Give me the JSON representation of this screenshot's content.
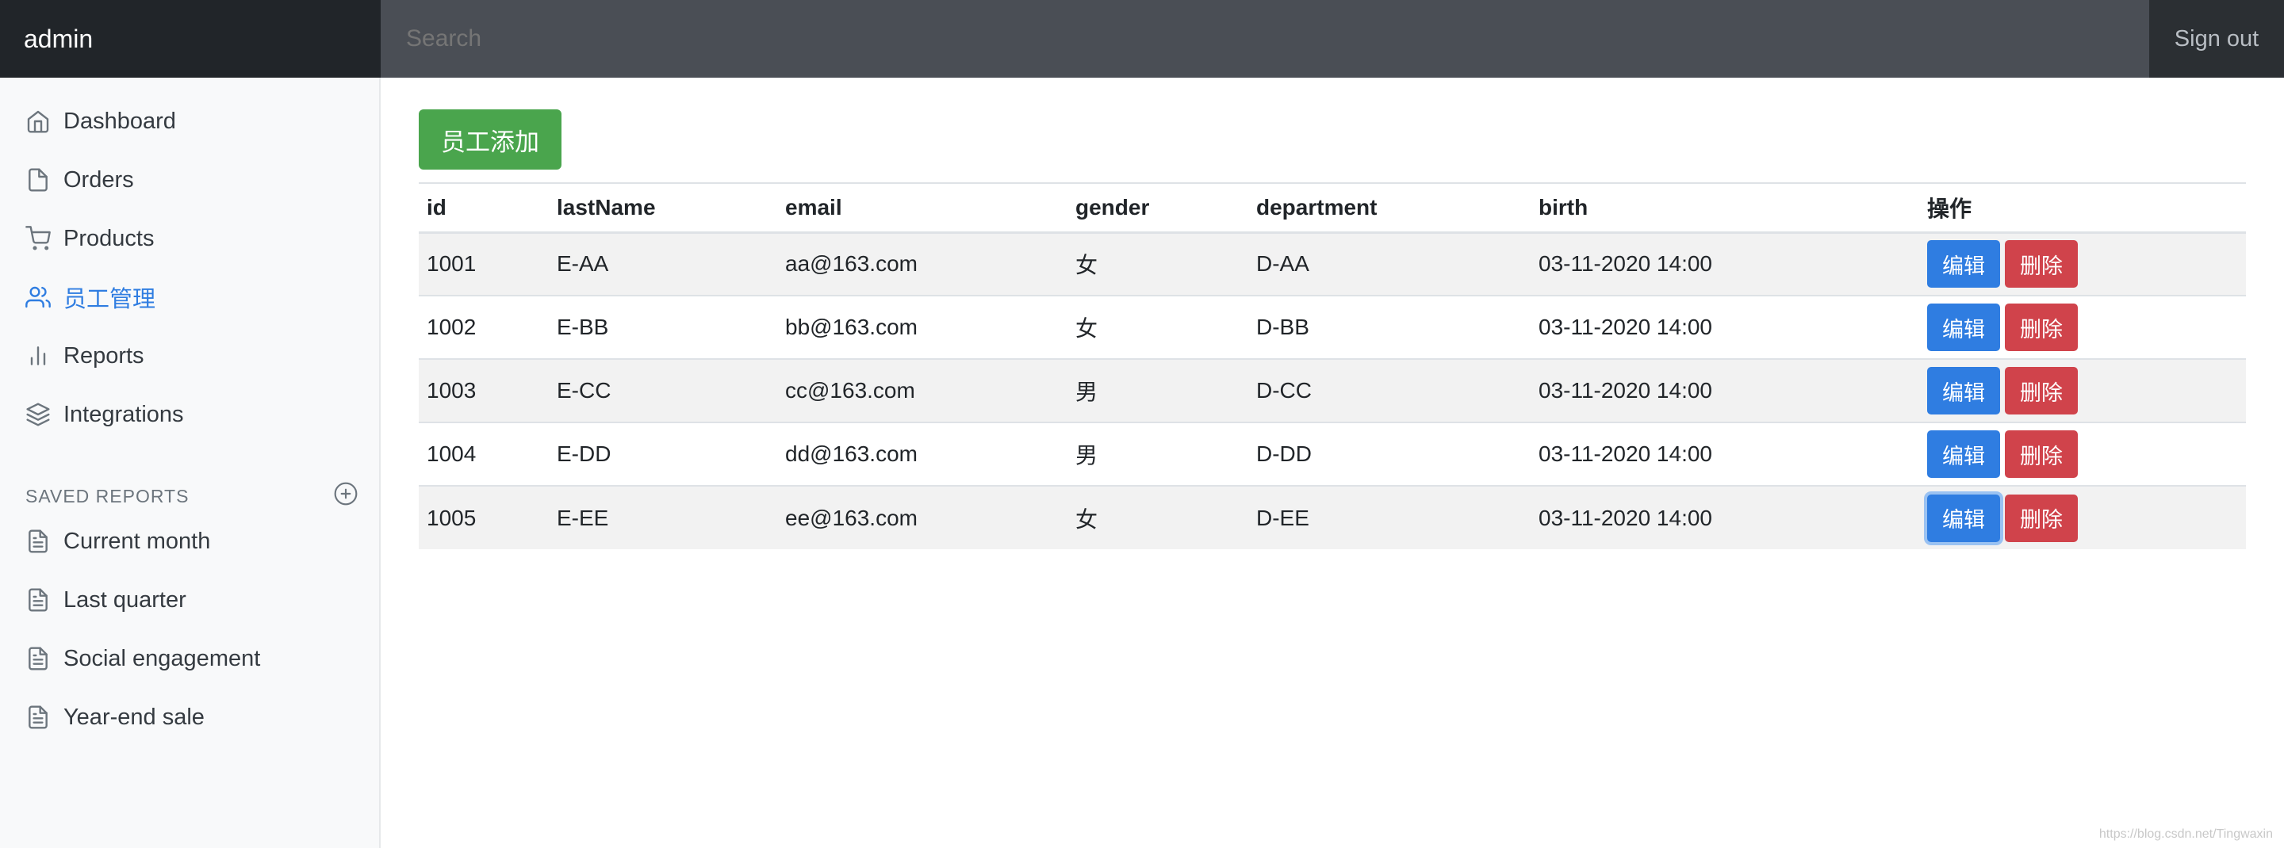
{
  "navbar": {
    "brand": "admin",
    "search_placeholder": "Search",
    "signout_label": "Sign out"
  },
  "sidebar": {
    "items": [
      {
        "label": "Dashboard",
        "icon": "home-icon"
      },
      {
        "label": "Orders",
        "icon": "file-icon"
      },
      {
        "label": "Products",
        "icon": "shopping-cart-icon"
      },
      {
        "label": "员工管理",
        "icon": "users-icon",
        "active": true
      },
      {
        "label": "Reports",
        "icon": "bar-chart-icon"
      },
      {
        "label": "Integrations",
        "icon": "layers-icon"
      }
    ],
    "saved_heading": "SAVED REPORTS",
    "saved_items": [
      {
        "label": "Current month",
        "icon": "file-text-icon"
      },
      {
        "label": "Last quarter",
        "icon": "file-text-icon"
      },
      {
        "label": "Social engagement",
        "icon": "file-text-icon"
      },
      {
        "label": "Year-end sale",
        "icon": "file-text-icon"
      }
    ]
  },
  "main": {
    "add_button": "员工添加",
    "table": {
      "headers": [
        "id",
        "lastName",
        "email",
        "gender",
        "department",
        "birth",
        "操作"
      ],
      "rows": [
        [
          "1001",
          "E-AA",
          "aa@163.com",
          "女",
          "D-AA",
          "03-11-2020 14:00"
        ],
        [
          "1002",
          "E-BB",
          "bb@163.com",
          "女",
          "D-BB",
          "03-11-2020 14:00"
        ],
        [
          "1003",
          "E-CC",
          "cc@163.com",
          "男",
          "D-CC",
          "03-11-2020 14:00"
        ],
        [
          "1004",
          "E-DD",
          "dd@163.com",
          "男",
          "D-DD",
          "03-11-2020 14:00"
        ],
        [
          "1005",
          "E-EE",
          "ee@163.com",
          "女",
          "D-EE",
          "03-11-2020 14:00"
        ]
      ],
      "edit_label": "编辑",
      "delete_label": "删除"
    }
  },
  "watermark": "https://blog.csdn.net/Tingwaxin",
  "colors": {
    "navbar": "#343a40",
    "brand_bg": "#212529",
    "accent": "#2f7de1",
    "success": "#4aa54d",
    "danger": "#d0434b"
  }
}
